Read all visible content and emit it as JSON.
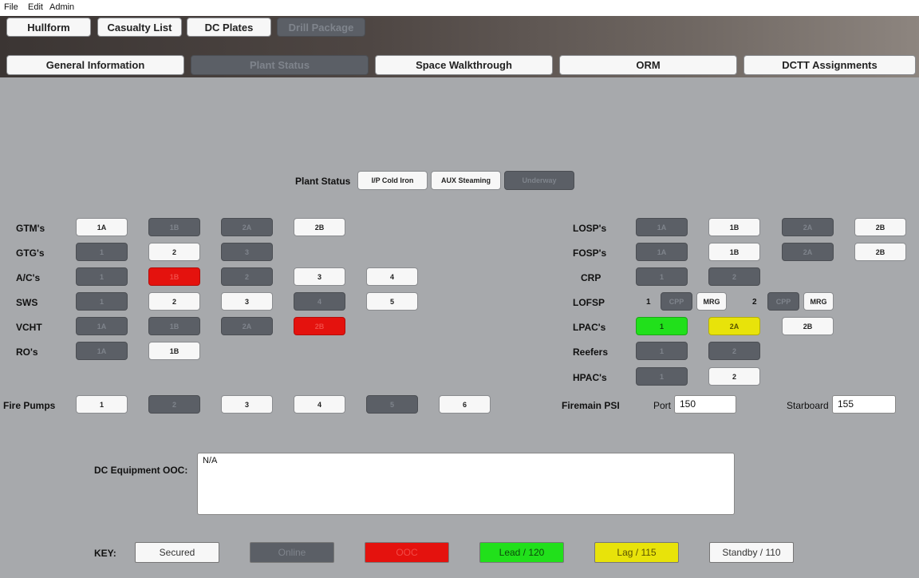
{
  "menu": {
    "file": "File",
    "edit": "Edit",
    "admin": "Admin"
  },
  "top_tabs": [
    "Hullform",
    "Casualty List",
    "DC Plates",
    "Drill Package"
  ],
  "sub_tabs": [
    "General Information",
    "Plant Status",
    "Space Walkthrough",
    "ORM",
    "DCTT Assignments"
  ],
  "plant_status": {
    "label": "Plant Status",
    "options": [
      "I/P Cold Iron",
      "AUX Steaming",
      "Underway"
    ]
  },
  "left_rows": {
    "gtm": {
      "label": "GTM's",
      "buttons": [
        "1A",
        "1B",
        "2A",
        "2B"
      ]
    },
    "gtg": {
      "label": "GTG's",
      "buttons": [
        "1",
        "2",
        "3"
      ]
    },
    "ac": {
      "label": "A/C's",
      "buttons": [
        "1",
        "1B",
        "2",
        "3",
        "4"
      ]
    },
    "sws": {
      "label": "SWS",
      "buttons": [
        "1",
        "2",
        "3",
        "4",
        "5"
      ]
    },
    "vcht": {
      "label": "VCHT",
      "buttons": [
        "1A",
        "1B",
        "2A",
        "2B"
      ]
    },
    "ro": {
      "label": "RO's",
      "buttons": [
        "1A",
        "1B"
      ]
    },
    "fire": {
      "label": "Fire Pumps",
      "buttons": [
        "1",
        "2",
        "3",
        "4",
        "5",
        "6"
      ]
    }
  },
  "right_rows": {
    "losp": {
      "label": "LOSP's",
      "buttons": [
        "1A",
        "1B",
        "2A",
        "2B"
      ]
    },
    "fosp": {
      "label": "FOSP's",
      "buttons": [
        "1A",
        "1B",
        "2A",
        "2B"
      ]
    },
    "crp": {
      "label": "CRP",
      "buttons": [
        "1",
        "2"
      ]
    },
    "lofsp": {
      "label": "LOFSP",
      "unit1": "1",
      "unit2": "2",
      "buttons": [
        "CPP",
        "MRG",
        "CPP",
        "MRG"
      ]
    },
    "lpac": {
      "label": "LPAC's",
      "buttons": [
        "1",
        "2A",
        "2B"
      ]
    },
    "reefers": {
      "label": "Reefers",
      "buttons": [
        "1",
        "2"
      ]
    },
    "hpac": {
      "label": "HPAC's",
      "buttons": [
        "1",
        "2"
      ]
    }
  },
  "firemain": {
    "label": "Firemain PSI",
    "port_label": "Port",
    "port_value": "150",
    "stbd_label": "Starboard",
    "stbd_value": "155"
  },
  "dc_equipment": {
    "label": "DC Equipment OOC:",
    "value": "N/A"
  },
  "key": {
    "label": "KEY:",
    "items": [
      "Secured",
      "Online",
      "OOC",
      "Lead / 120",
      "Lag / 115",
      "Standby / 110"
    ]
  },
  "colors": {
    "secured": "#f7f7f7",
    "online": "#5b5f66",
    "ooc": "#e4120e",
    "lead": "#21e01b",
    "lag": "#e8e30a",
    "background": "#a7a9ac"
  }
}
